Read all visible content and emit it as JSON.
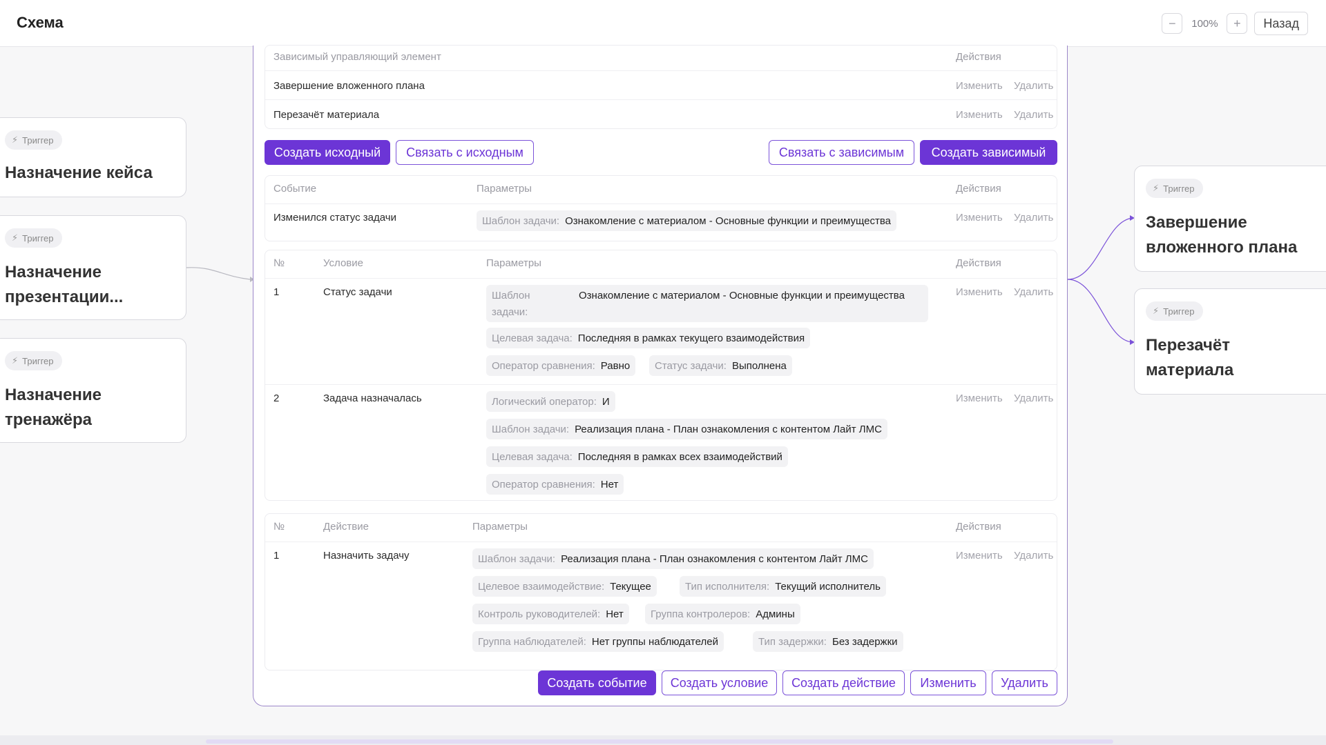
{
  "header": {
    "title": "Схема",
    "zoom_out": "−",
    "zoom_level": "100%",
    "zoom_in": "+",
    "back_label": "Назад"
  },
  "left_nodes": [
    {
      "chip": "Триггер",
      "title": "Назначение кейса"
    },
    {
      "chip": "Триггер",
      "title": "Назначение презентации..."
    },
    {
      "chip": "Триггер",
      "title": "Назначение тренажёра"
    }
  ],
  "right_nodes": [
    {
      "chip": "Триггер",
      "title": "Завершение вложенного плана"
    },
    {
      "chip": "Триггер",
      "title": "Перезачёт материала"
    }
  ],
  "dependents": {
    "header_col": "Зависимый управляющий элемент",
    "header_actions": "Действия",
    "rows": [
      {
        "name": "Завершение вложенного плана",
        "edit": "Изменить",
        "delete": "Удалить"
      },
      {
        "name": "Перезачёт материала",
        "edit": "Изменить",
        "delete": "Удалить"
      }
    ]
  },
  "link_buttons": {
    "create_source": "Создать исходный",
    "link_source": "Связать с исходным",
    "link_dependent": "Связать с зависимым",
    "create_dependent": "Создать зависимый"
  },
  "events": {
    "headers": {
      "event": "Событие",
      "params": "Параметры",
      "actions": "Действия"
    },
    "row": {
      "event": "Изменился статус задачи",
      "param_key": "Шаблон задачи:",
      "param_value": "Ознакомление с материалом - Основные функции и преимущества",
      "edit": "Изменить",
      "delete": "Удалить"
    }
  },
  "conditions": {
    "headers": {
      "num": "№",
      "condition": "Условие",
      "params": "Параметры",
      "actions": "Действия"
    },
    "rows": [
      {
        "num": "1",
        "condition": "Статус задачи",
        "tpl_key": "Шаблон задачи:",
        "tpl_value": "Ознакомление с материалом - Основные функции и преимущества",
        "target_key": "Целевая задача:",
        "target_value": "Последняя в рамках текущего взаимодействия",
        "op_key": "Оператор сравнения:",
        "op_value": "Равно",
        "status_key": "Статус задачи:",
        "status_value": "Выполнена",
        "edit": "Изменить",
        "delete": "Удалить"
      },
      {
        "num": "2",
        "condition": "Задача назначалась",
        "logic_key": "Логический оператор:",
        "logic_value": "И",
        "tpl_key": "Шаблон задачи:",
        "tpl_value": "Реализация плана - План ознакомления с контентом Лайт ЛМС",
        "target_key": "Целевая задача:",
        "target_value": "Последняя в рамках всех взаимодействий",
        "op_key": "Оператор сравнения:",
        "op_value": "Нет",
        "edit": "Изменить",
        "delete": "Удалить"
      }
    ]
  },
  "actions": {
    "headers": {
      "num": "№",
      "action": "Действие",
      "params": "Параметры",
      "actions": "Действия"
    },
    "row": {
      "num": "1",
      "action": "Назначить задачу",
      "tpl_key": "Шаблон задачи:",
      "tpl_value": "Реализация плана - План ознакомления с контентом Лайт ЛМС",
      "interact_key": "Целевое взаимодействие:",
      "interact_value": "Текущее",
      "executor_key": "Тип исполнителя:",
      "executor_value": "Текущий исполнитель",
      "control_key": "Контроль руководителей:",
      "control_value": "Нет",
      "controllers_key": "Группа контролеров:",
      "controllers_value": "Админы",
      "observers_key": "Группа наблюдателей:",
      "observers_value": "Нет группы наблюдателей",
      "delay_key": "Тип задержки:",
      "delay_value": "Без задержки",
      "edit": "Изменить",
      "delete": "Удалить"
    }
  },
  "footer_buttons": {
    "create_event": "Создать событие",
    "create_condition": "Создать условие",
    "create_action": "Создать действие",
    "edit": "Изменить",
    "delete": "Удалить"
  },
  "colors": {
    "accent": "#6c35d6",
    "accent_border": "#9b86c9",
    "muted": "#9a9aa2"
  }
}
